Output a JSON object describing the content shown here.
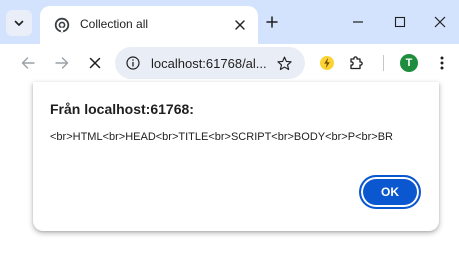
{
  "tab": {
    "title": "Collection all"
  },
  "omnibox": {
    "url": "localhost:61768/al..."
  },
  "profile": {
    "initial": "T"
  },
  "dialog": {
    "title": "Från localhost:61768:",
    "message": "<br>HTML<br>HEAD<br>TITLE<br>SCRIPT<br>BODY<br>P<br>BR",
    "ok_label": "OK"
  },
  "colors": {
    "tabstrip_bg": "#d3e3fd",
    "accent": "#0b57d0",
    "avatar_bg": "#1e8e3e",
    "omnibox_bg": "#e9eef6"
  },
  "icons": {
    "tab_search": "chevron-down-icon",
    "favicon": "collection-favicon-icon",
    "tab_close": "close-icon",
    "new_tab": "plus-icon",
    "minimize": "minimize-icon",
    "maximize": "maximize-icon",
    "window_close": "close-icon",
    "back": "arrow-left-icon",
    "forward": "arrow-right-icon",
    "stop": "close-icon",
    "site_info": "info-icon",
    "bookmark": "star-icon",
    "extension_bolt": "bolt-icon",
    "extensions": "puzzle-icon",
    "menu": "kebab-menu-icon"
  }
}
